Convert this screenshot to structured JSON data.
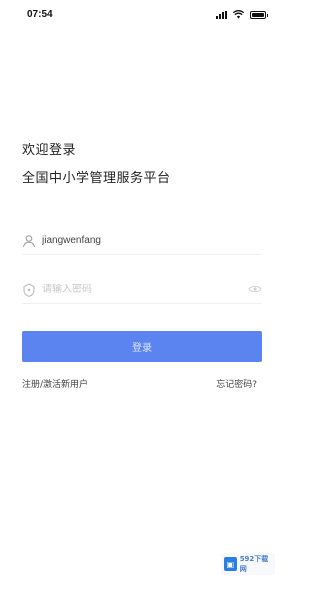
{
  "status_bar": {
    "time": "07:54",
    "battery_level": 1.0
  },
  "header": {
    "welcome": "欢迎登录",
    "platform_name": "全国中小学管理服务平台"
  },
  "form": {
    "username_value": "jiangwenfang",
    "password_placeholder": "请输入密码",
    "login_label": "登录"
  },
  "links": {
    "register": "注册/激活新用户",
    "forgot": "忘记密码?"
  },
  "watermark": {
    "text": "592下载网"
  },
  "colors": {
    "primary": "#5b84f0"
  }
}
